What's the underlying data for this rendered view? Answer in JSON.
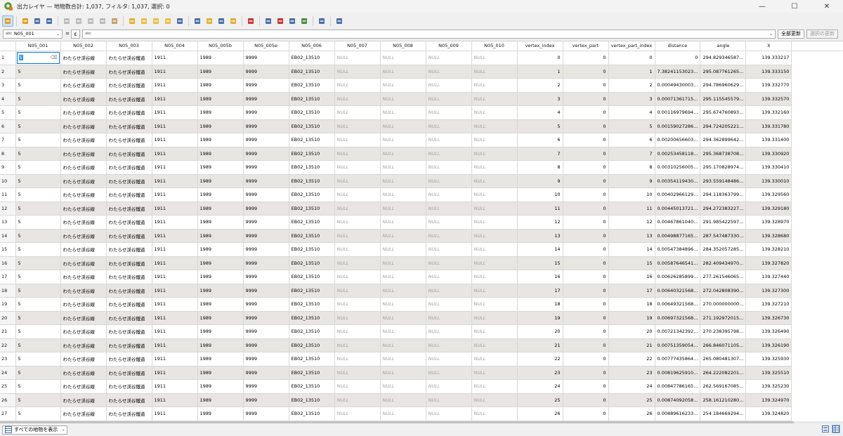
{
  "window": {
    "title": "出力レイヤ — 地物数合計: 1,037, フィルタ: 1,037, 選択: 0",
    "minimize": "—",
    "maximize": "☐",
    "close": "✕"
  },
  "toolbar": {
    "items": [
      {
        "name": "toggle-editing-icon",
        "color": "#e0a020"
      },
      {
        "name": "multi-edit-icon",
        "color": "#e0a020"
      },
      {
        "name": "save-edits-icon",
        "color": "#4a6fa5"
      },
      {
        "name": "reload-table-icon",
        "color": "#4a6fa5"
      },
      {
        "name": "add-feature-icon",
        "color": "#bbbbbb"
      },
      {
        "name": "delete-feature-icon",
        "color": "#bbbbbb"
      },
      {
        "name": "cut-icon",
        "color": "#bbbbbb"
      },
      {
        "name": "copy-icon",
        "color": "#bbbbbb"
      },
      {
        "name": "paste-icon",
        "color": "#c8a060"
      },
      {
        "name": "select-expression-icon",
        "color": "#e0b030"
      },
      {
        "name": "select-all-icon",
        "color": "#e8c040"
      },
      {
        "name": "invert-selection-icon",
        "color": "#e8c040"
      },
      {
        "name": "deselect-all-icon",
        "color": "#e8c040"
      },
      {
        "name": "filter-select-icon",
        "color": "#4a6fa5"
      },
      {
        "name": "move-selection-top-icon",
        "color": "#4a6fa5"
      },
      {
        "name": "pan-map-icon",
        "color": "#e0b030"
      },
      {
        "name": "zoom-map-icon",
        "color": "#4a6fa5"
      },
      {
        "name": "copy-rows-icon",
        "color": "#e0b030"
      },
      {
        "name": "paste-features-icon",
        "color": "#cc3333"
      },
      {
        "name": "new-field-icon",
        "color": "#4a6fa5"
      },
      {
        "name": "delete-field-icon",
        "color": "#cc3333"
      },
      {
        "name": "field-calculator-icon",
        "color": "#4a6fa5"
      },
      {
        "name": "conditional-format-icon",
        "color": "#4a8a40"
      },
      {
        "name": "actions-icon",
        "color": "#4a6fa5"
      },
      {
        "name": "dock-table-icon",
        "color": "#4a6fa5"
      }
    ]
  },
  "filter": {
    "field_prefix": "abc",
    "field_value": "N05_001",
    "equals": "=",
    "expression_button": "ε",
    "input_prefix": "abc",
    "update_all": "全部更新",
    "update_selected": "選択の更新"
  },
  "table": {
    "columns": [
      "N05_001",
      "N05_002",
      "N05_003",
      "N05_004",
      "N05_005b",
      "N05_005e",
      "N05_006",
      "N05_007",
      "N05_008",
      "N05_009",
      "N05_010",
      "vertex_index",
      "vertex_part",
      "vertex_part_index",
      "distance",
      "angle",
      "X"
    ],
    "rows": [
      {
        "row": "1",
        "n001": "5",
        "n002": "わたらせ渓谷線",
        "n003": "わたらせ渓谷鐵道",
        "n004": "1911",
        "n005b": "1989",
        "n005e": "9999",
        "n006": "EB02_13510",
        "n007": "NULL",
        "n008": "NULL",
        "n009": "NULL",
        "n010": "NULL",
        "vi": "0",
        "vp": "0",
        "vpi": "0",
        "dist": "0",
        "angle": "294.829346587...",
        "x": "139.333217"
      },
      {
        "row": "2",
        "n001": "5",
        "n002": "わたらせ渓谷線",
        "n003": "わたらせ渓谷鐵道",
        "n004": "1911",
        "n005b": "1989",
        "n005e": "9999",
        "n006": "EB02_13510",
        "n007": "NULL",
        "n008": "NULL",
        "n009": "NULL",
        "n010": "NULL",
        "vi": "1",
        "vp": "0",
        "vpi": "1",
        "dist": "7.38241153023...",
        "angle": "295.087761265...",
        "x": "139.333150"
      },
      {
        "row": "3",
        "n001": "5",
        "n002": "わたらせ渓谷線",
        "n003": "わたらせ渓谷鐵道",
        "n004": "1911",
        "n005b": "1989",
        "n005e": "9999",
        "n006": "EB02_13510",
        "n007": "NULL",
        "n008": "NULL",
        "n009": "NULL",
        "n010": "NULL",
        "vi": "2",
        "vp": "0",
        "vpi": "2",
        "dist": "0.00049430003...",
        "angle": "294.786960629...",
        "x": "139.332770"
      },
      {
        "row": "4",
        "n001": "5",
        "n002": "わたらせ渓谷線",
        "n003": "わたらせ渓谷鐵道",
        "n004": "1911",
        "n005b": "1989",
        "n005e": "9999",
        "n006": "EB02_13510",
        "n007": "NULL",
        "n008": "NULL",
        "n009": "NULL",
        "n010": "NULL",
        "vi": "3",
        "vp": "0",
        "vpi": "3",
        "dist": "0.00071361715...",
        "angle": "295.115545579...",
        "x": "139.332570"
      },
      {
        "row": "5",
        "n001": "5",
        "n002": "わたらせ渓谷線",
        "n003": "わたらせ渓谷鐵道",
        "n004": "1911",
        "n005b": "1989",
        "n005e": "9999",
        "n006": "EB02_13510",
        "n007": "NULL",
        "n008": "NULL",
        "n009": "NULL",
        "n010": "NULL",
        "vi": "4",
        "vp": "0",
        "vpi": "4",
        "dist": "0.00116979694...",
        "angle": "295.674760893...",
        "x": "139.332160"
      },
      {
        "row": "6",
        "n001": "5",
        "n002": "わたらせ渓谷線",
        "n003": "わたらせ渓谷鐵道",
        "n004": "1911",
        "n005b": "1989",
        "n005e": "9999",
        "n006": "EB02_13510",
        "n007": "NULL",
        "n008": "NULL",
        "n009": "NULL",
        "n010": "NULL",
        "vi": "5",
        "vp": "0",
        "vpi": "5",
        "dist": "0.00159027286...",
        "angle": "294.724205221...",
        "x": "139.331780"
      },
      {
        "row": "7",
        "n001": "5",
        "n002": "わたらせ渓谷線",
        "n003": "わたらせ渓谷鐵道",
        "n004": "1911",
        "n005b": "1989",
        "n005e": "9999",
        "n006": "EB02_13510",
        "n007": "NULL",
        "n008": "NULL",
        "n009": "NULL",
        "n010": "NULL",
        "vi": "6",
        "vp": "0",
        "vpi": "6",
        "dist": "0.00200656603...",
        "angle": "294.362899642...",
        "x": "139.331400"
      },
      {
        "row": "8",
        "n001": "5",
        "n002": "わたらせ渓谷線",
        "n003": "わたらせ渓谷鐵道",
        "n004": "1911",
        "n005b": "1989",
        "n005e": "9999",
        "n006": "EB02_13510",
        "n007": "NULL",
        "n008": "NULL",
        "n009": "NULL",
        "n010": "NULL",
        "vi": "7",
        "vp": "0",
        "vpi": "7",
        "dist": "0.00253458118...",
        "angle": "295.368738708...",
        "x": "139.330920"
      },
      {
        "row": "9",
        "n001": "5",
        "n002": "わたらせ渓谷線",
        "n003": "わたらせ渓谷鐵道",
        "n004": "1911",
        "n005b": "1989",
        "n005e": "9999",
        "n006": "EB02_13510",
        "n007": "NULL",
        "n008": "NULL",
        "n009": "NULL",
        "n010": "NULL",
        "vi": "8",
        "vp": "0",
        "vpi": "8",
        "dist": "0.00310256005...",
        "angle": "295.170828974...",
        "x": "139.330410"
      },
      {
        "row": "10",
        "n001": "5",
        "n002": "わたらせ渓谷線",
        "n003": "わたらせ渓谷鐵道",
        "n004": "1911",
        "n005b": "1989",
        "n005e": "9999",
        "n006": "EB02_13510",
        "n007": "NULL",
        "n008": "NULL",
        "n009": "NULL",
        "n010": "NULL",
        "vi": "9",
        "vp": "0",
        "vpi": "9",
        "dist": "0.00354119430...",
        "angle": "293.559148486...",
        "x": "139.330010"
      },
      {
        "row": "11",
        "n001": "5",
        "n002": "わたらせ渓谷線",
        "n003": "わたらせ渓谷鐵道",
        "n004": "1911",
        "n005b": "1989",
        "n005e": "9999",
        "n006": "EB02_13510",
        "n007": "NULL",
        "n008": "NULL",
        "n009": "NULL",
        "n010": "NULL",
        "vi": "10",
        "vp": "0",
        "vpi": "10",
        "dist": "0.00402966129...",
        "angle": "294.118363799...",
        "x": "139.329560"
      },
      {
        "row": "12",
        "n001": "5",
        "n002": "わたらせ渓谷線",
        "n003": "わたらせ渓谷鐵道",
        "n004": "1911",
        "n005b": "1989",
        "n005e": "9999",
        "n006": "EB02_13510",
        "n007": "NULL",
        "n008": "NULL",
        "n009": "NULL",
        "n010": "NULL",
        "vi": "11",
        "vp": "0",
        "vpi": "11",
        "dist": "0.00445013721...",
        "angle": "294.272383227...",
        "x": "139.329180"
      },
      {
        "row": "13",
        "n001": "5",
        "n002": "わたらせ渓谷線",
        "n003": "わたらせ渓谷鐵道",
        "n004": "1911",
        "n005b": "1989",
        "n005e": "9999",
        "n006": "EB02_13510",
        "n007": "NULL",
        "n008": "NULL",
        "n009": "NULL",
        "n010": "NULL",
        "vi": "12",
        "vp": "0",
        "vpi": "12",
        "dist": "0.00467861040...",
        "angle": "291.985422597...",
        "x": "139.328970"
      },
      {
        "row": "14",
        "n001": "5",
        "n002": "わたらせ渓谷線",
        "n003": "わたらせ渓谷鐵道",
        "n004": "1911",
        "n005b": "1989",
        "n005e": "9999",
        "n006": "EB02_13510",
        "n007": "NULL",
        "n008": "NULL",
        "n009": "NULL",
        "n010": "NULL",
        "vi": "13",
        "vp": "0",
        "vpi": "13",
        "dist": "0.00498877165...",
        "angle": "287.547487330...",
        "x": "139.328680"
      },
      {
        "row": "15",
        "n001": "5",
        "n002": "わたらせ渓谷線",
        "n003": "わたらせ渓谷鐵道",
        "n004": "1911",
        "n005b": "1989",
        "n005e": "9999",
        "n006": "EB02_13510",
        "n007": "NULL",
        "n008": "NULL",
        "n009": "NULL",
        "n010": "NULL",
        "vi": "14",
        "vp": "0",
        "vpi": "14",
        "dist": "0.00547384896...",
        "angle": "284.352057285...",
        "x": "139.328210"
      },
      {
        "row": "16",
        "n001": "5",
        "n002": "わたらせ渓谷線",
        "n003": "わたらせ渓谷鐵道",
        "n004": "1911",
        "n005b": "1989",
        "n005e": "9999",
        "n006": "EB02_13510",
        "n007": "NULL",
        "n008": "NULL",
        "n009": "NULL",
        "n010": "NULL",
        "vi": "15",
        "vp": "0",
        "vpi": "15",
        "dist": "0.00587646541...",
        "angle": "282.409434970...",
        "x": "139.327820"
      },
      {
        "row": "17",
        "n001": "5",
        "n002": "わたらせ渓谷線",
        "n003": "わたらせ渓谷鐵道",
        "n004": "1911",
        "n005b": "1989",
        "n005e": "9999",
        "n006": "EB02_13510",
        "n007": "NULL",
        "n008": "NULL",
        "n009": "NULL",
        "n010": "NULL",
        "vi": "16",
        "vp": "0",
        "vpi": "16",
        "dist": "0.00626285899...",
        "angle": "277.261546065...",
        "x": "139.327440"
      },
      {
        "row": "18",
        "n001": "5",
        "n002": "わたらせ渓谷線",
        "n003": "わたらせ渓谷鐵道",
        "n004": "1911",
        "n005b": "1989",
        "n005e": "9999",
        "n006": "EB02_13510",
        "n007": "NULL",
        "n008": "NULL",
        "n009": "NULL",
        "n010": "NULL",
        "vi": "17",
        "vp": "0",
        "vpi": "17",
        "dist": "0.00640321568...",
        "angle": "272.042808390...",
        "x": "139.327300"
      },
      {
        "row": "19",
        "n001": "5",
        "n002": "わたらせ渓谷線",
        "n003": "わたらせ渓谷鐵道",
        "n004": "1911",
        "n005b": "1989",
        "n005e": "9999",
        "n006": "EB02_13510",
        "n007": "NULL",
        "n008": "NULL",
        "n009": "NULL",
        "n010": "NULL",
        "vi": "18",
        "vp": "0",
        "vpi": "18",
        "dist": "0.00649321568...",
        "angle": "270.000000000...",
        "x": "139.327210"
      },
      {
        "row": "20",
        "n001": "5",
        "n002": "わたらせ渓谷線",
        "n003": "わたらせ渓谷鐵道",
        "n004": "1911",
        "n005b": "1989",
        "n005e": "9999",
        "n006": "EB02_13510",
        "n007": "NULL",
        "n008": "NULL",
        "n009": "NULL",
        "n010": "NULL",
        "vi": "19",
        "vp": "0",
        "vpi": "19",
        "dist": "0.00697321568...",
        "angle": "271.192972015...",
        "x": "139.326730"
      },
      {
        "row": "21",
        "n001": "5",
        "n002": "わたらせ渓谷線",
        "n003": "わたらせ渓谷鐵道",
        "n004": "1911",
        "n005b": "1989",
        "n005e": "9999",
        "n006": "EB02_13510",
        "n007": "NULL",
        "n008": "NULL",
        "n009": "NULL",
        "n010": "NULL",
        "vi": "20",
        "vp": "0",
        "vpi": "20",
        "dist": "0.00721342392...",
        "angle": "270.238395798...",
        "x": "139.326490"
      },
      {
        "row": "22",
        "n001": "5",
        "n002": "わたらせ渓谷線",
        "n003": "わたらせ渓谷鐵道",
        "n004": "1911",
        "n005b": "1989",
        "n005e": "9999",
        "n006": "EB02_13510",
        "n007": "NULL",
        "n008": "NULL",
        "n009": "NULL",
        "n010": "NULL",
        "vi": "21",
        "vp": "0",
        "vpi": "21",
        "dist": "0.00751359054...",
        "angle": "266.846071105...",
        "x": "139.326190"
      },
      {
        "row": "23",
        "n001": "5",
        "n002": "わたらせ渓谷線",
        "n003": "わたらせ渓谷鐵道",
        "n004": "1911",
        "n005b": "1989",
        "n005e": "9999",
        "n006": "EB02_13510",
        "n007": "NULL",
        "n008": "NULL",
        "n009": "NULL",
        "n010": "NULL",
        "vi": "22",
        "vp": "0",
        "vpi": "22",
        "dist": "0.00777435864...",
        "angle": "265.080481307...",
        "x": "139.325930"
      },
      {
        "row": "24",
        "n001": "5",
        "n002": "わたらせ渓谷線",
        "n003": "わたらせ渓谷鐵道",
        "n004": "1911",
        "n005b": "1989",
        "n005e": "9999",
        "n006": "EB02_13510",
        "n007": "NULL",
        "n008": "NULL",
        "n009": "NULL",
        "n010": "NULL",
        "vi": "23",
        "vp": "0",
        "vpi": "23",
        "dist": "0.00819625910...",
        "angle": "264.222082201...",
        "x": "139.325510"
      },
      {
        "row": "25",
        "n001": "5",
        "n002": "わたらせ渓谷線",
        "n003": "わたらせ渓谷鐵道",
        "n004": "1911",
        "n005b": "1989",
        "n005e": "9999",
        "n006": "EB02_13510",
        "n007": "NULL",
        "n008": "NULL",
        "n009": "NULL",
        "n010": "NULL",
        "vi": "24",
        "vp": "0",
        "vpi": "24",
        "dist": "0.00847786165...",
        "angle": "262.569167085...",
        "x": "139.325230"
      },
      {
        "row": "26",
        "n001": "5",
        "n002": "わたらせ渓谷線",
        "n003": "わたらせ渓谷鐵道",
        "n004": "1911",
        "n005b": "1989",
        "n005e": "9999",
        "n006": "EB02_13510",
        "n007": "NULL",
        "n008": "NULL",
        "n009": "NULL",
        "n010": "NULL",
        "vi": "25",
        "vp": "0",
        "vpi": "25",
        "dist": "0.00874092058...",
        "angle": "258.161210280...",
        "x": "139.324970"
      },
      {
        "row": "27",
        "n001": "5",
        "n002": "わたらせ渓谷線",
        "n003": "わたらせ渓谷鐵道",
        "n004": "1911",
        "n005b": "1989",
        "n005e": "9999",
        "n006": "EB02_13510",
        "n007": "NULL",
        "n008": "NULL",
        "n009": "NULL",
        "n010": "NULL",
        "vi": "26",
        "vp": "0",
        "vpi": "26",
        "dist": "0.00889616233...",
        "angle": "254.184669294...",
        "x": "139.324820"
      }
    ]
  },
  "status": {
    "show_all": "すべての地物を表示"
  }
}
